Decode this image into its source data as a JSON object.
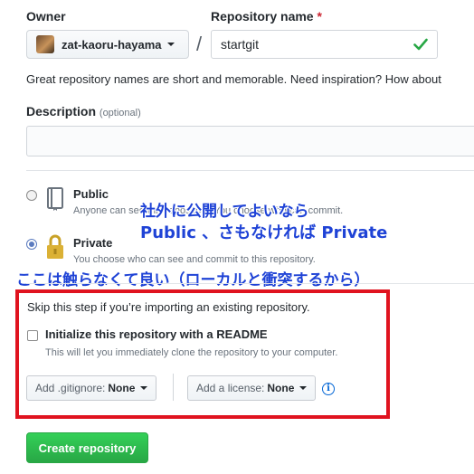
{
  "owner": {
    "label": "Owner",
    "value": "zat-kaoru-hayama"
  },
  "repo_name": {
    "label": "Repository name",
    "required_mark": "*",
    "value": "startgit",
    "separator": "/"
  },
  "hint": "Great repository names are short and memorable. Need inspiration? How about",
  "description": {
    "label": "Description",
    "optional": "(optional)",
    "value": ""
  },
  "visibility": {
    "public": {
      "title": "Public",
      "note": "Anyone can see this repository. You choose who can commit.",
      "selected": false
    },
    "private": {
      "title": "Private",
      "note": "You choose who can see and commit to this repository.",
      "selected": true
    }
  },
  "annotations": {
    "line1": "社外に公開してよいなら",
    "line2": "Public 、さもなければ Private",
    "line3": "ここは触らなくて良い（ローカルと衝突するから）",
    "text_color": "#1f43d6",
    "box_color": "#e0131f"
  },
  "init": {
    "skip_note": "Skip this step if you’re importing an existing repository.",
    "readme_label": "Initialize this repository with a README",
    "readme_note": "This will let you immediately clone the repository to your computer.",
    "readme_checked": false
  },
  "gitignore": {
    "label": "Add .gitignore:",
    "value": "None"
  },
  "license": {
    "label": "Add a license:",
    "value": "None"
  },
  "info_icon": "i",
  "create_button": "Create repository",
  "colors": {
    "accent_green": "#28a745",
    "check_green": "#28a745",
    "link_blue": "#0366d6"
  }
}
